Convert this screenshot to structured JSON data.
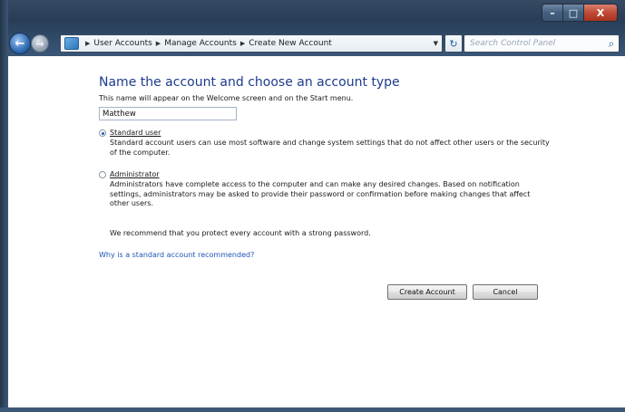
{
  "window": {
    "caption_buttons": {
      "minimize": "–",
      "maximize": "□",
      "close": "X"
    }
  },
  "nav": {
    "back_icon": "back-arrow-icon",
    "forward_icon": "forward-arrow-icon"
  },
  "address_bar": {
    "icon": "control-panel-icon",
    "breadcrumbs": [
      "User Accounts",
      "Manage Accounts",
      "Create New Account"
    ],
    "dropdown_icon": "chevron-down-icon",
    "refresh_icon": "refresh-icon"
  },
  "search": {
    "placeholder": "Search Control Panel",
    "icon": "search-icon"
  },
  "main": {
    "heading": "Name the account and choose an account type",
    "description": "This name will appear on the Welcome screen and on the Start menu.",
    "name_value": "Matthew",
    "options": [
      {
        "label": "Standard user",
        "selected": true,
        "description": "Standard account users can use most software and change system settings that do not affect other users or the security of the computer."
      },
      {
        "label": "Administrator",
        "selected": false,
        "description": "Administrators have complete access to the computer and can make any desired changes. Based on notification settings, administrators may be asked to provide their password or confirmation before making changes that affect other users."
      }
    ],
    "recommendation": "We recommend that you protect every account with a strong password.",
    "why_link": "Why is a standard account recommended?",
    "buttons": {
      "create": "Create Account",
      "cancel": "Cancel"
    }
  }
}
